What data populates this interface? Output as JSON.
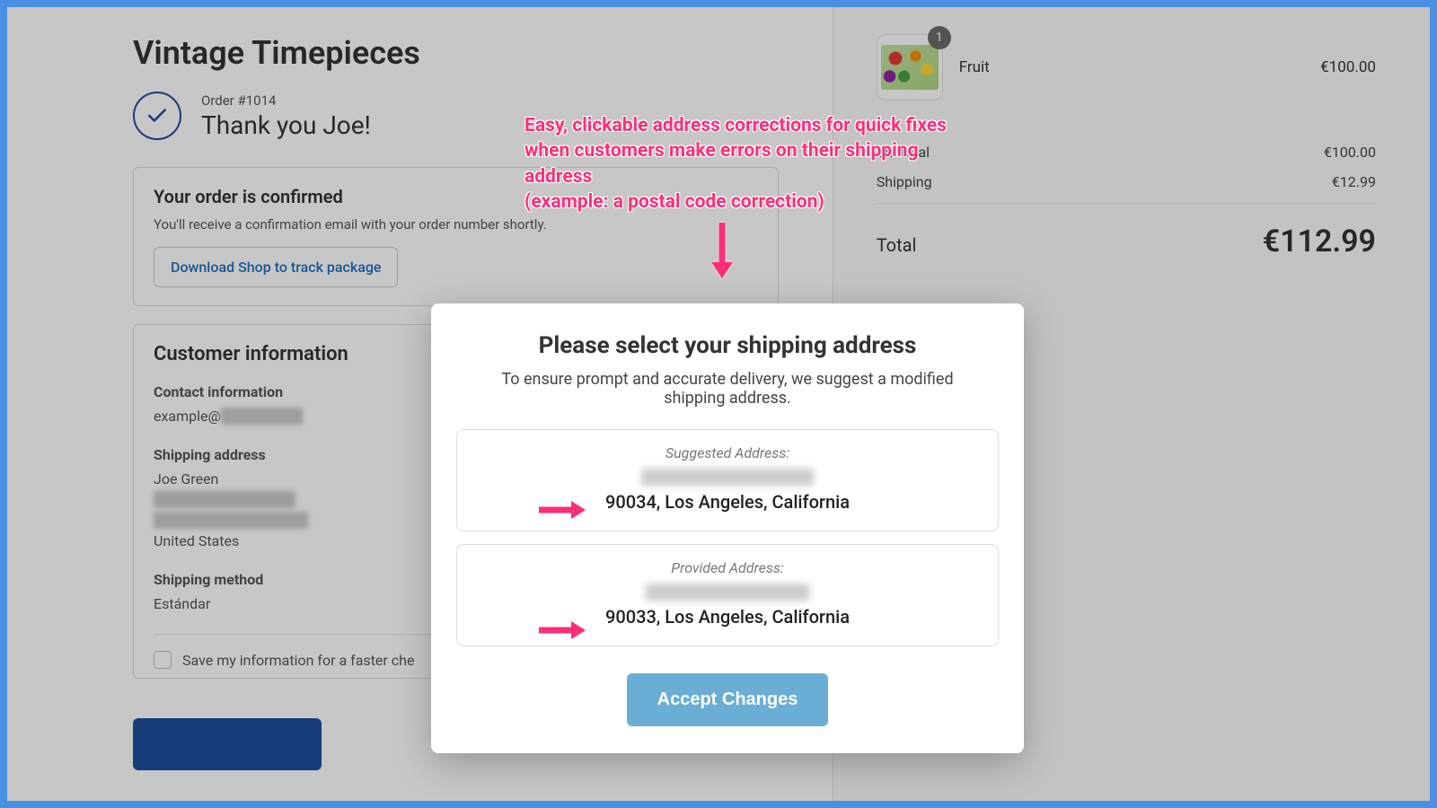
{
  "store": {
    "name": "Vintage Timepieces"
  },
  "order": {
    "number_label": "Order #1014",
    "thank_you": "Thank you Joe!"
  },
  "confirm_card": {
    "title": "Your order is confirmed",
    "subtext": "You'll receive a confirmation email with your order number shortly.",
    "download_label": "Download Shop to track package"
  },
  "customer_info": {
    "heading": "Customer information",
    "contact_heading": "Contact information",
    "contact_email_prefix": "example@",
    "shipping_heading": "Shipping address",
    "shipping_name": "Joe Green",
    "shipping_country": "United States",
    "method_heading": "Shipping method",
    "method_value": "Estándar",
    "save_label": "Save my information for a faster che"
  },
  "cart": {
    "item_name": "Fruit",
    "item_qty": "1",
    "item_price": "€100.00",
    "subtotal_label": "Subtotal",
    "subtotal_value": "€100.00",
    "shipping_label": "Shipping",
    "shipping_value": "€12.99",
    "total_label": "Total",
    "total_value": "€112.99"
  },
  "annotation": {
    "text": "Easy, clickable address corrections for quick fixes when customers make errors on their shipping address\n(example: a postal code correction)"
  },
  "modal": {
    "title": "Please select your shipping address",
    "desc": "To ensure prompt and accurate delivery, we suggest a modified shipping address.",
    "suggested_label": "Suggested Address:",
    "suggested_city": "90034, Los Angeles, California",
    "provided_label": "Provided Address:",
    "provided_city": "90033, Los Angeles, California",
    "accept_label": "Accept Changes"
  }
}
